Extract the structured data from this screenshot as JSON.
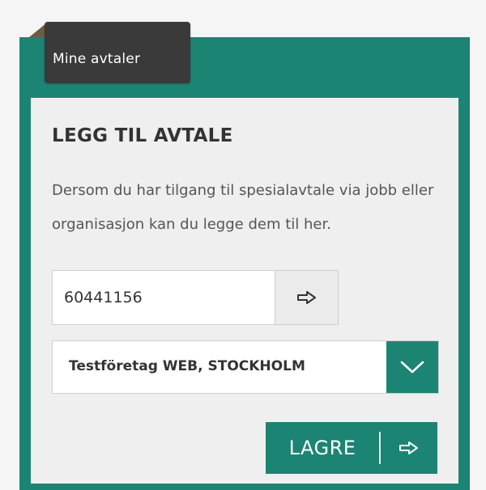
{
  "tab": {
    "label": "Mine avtaler"
  },
  "form": {
    "heading": "LEGG TIL AVTALE",
    "description": "Dersom du har tilgang til spesialavtale via jobb eller organisasjon kan du legge dem til her.",
    "code_value": "60441156",
    "select_value": "Testföretag WEB, STOCKHOLM",
    "save_label": "LAGRE"
  },
  "colors": {
    "accent": "#1c8473",
    "tab_background": "#3a3a3a",
    "card_background": "#efefef"
  },
  "icons": {
    "submit_code": "arrow-right-outline-icon",
    "dropdown": "chevron-down-icon",
    "save": "arrow-right-outline-icon"
  }
}
